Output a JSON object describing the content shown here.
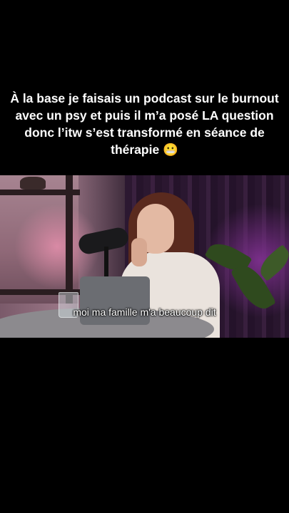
{
  "caption": {
    "text": "À la base je faisais un podcast sur le burnout avec un psy et puis il m’a posé LA question donc l’itw s’est transformé en séance de thérapie",
    "emoji": "😬"
  },
  "video": {
    "subtitle": "moi ma famille m'a beaucoup dit"
  }
}
